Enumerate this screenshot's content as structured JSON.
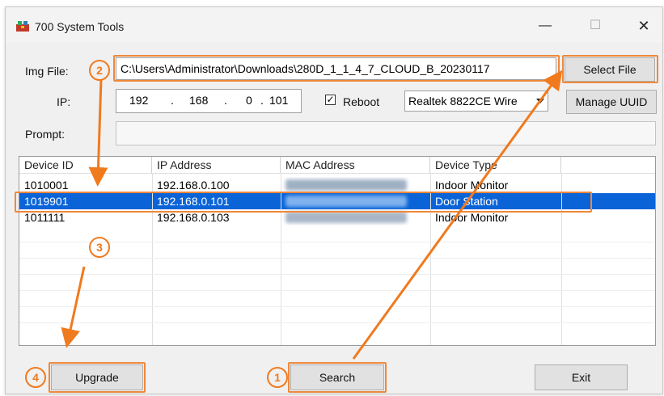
{
  "window": {
    "title": "700 System Tools",
    "controls": {
      "minimize": "—",
      "maximize": "☐",
      "close": "✕"
    }
  },
  "form": {
    "img_file_label": "Img File:",
    "img_file_value": "C:\\Users\\Administrator\\Downloads\\280D_1_1_4_7_CLOUD_B_20230117",
    "select_file_label": "Select File",
    "ip_label": "IP:",
    "ip_octets": [
      "192",
      "168",
      "0",
      "101"
    ],
    "ip_dots": [
      ".",
      ".",
      "."
    ],
    "reboot_label": "Reboot",
    "reboot_checked": "✓",
    "adapter_value": "Realtek 8822CE Wire",
    "manage_uuid_label": "Manage UUID",
    "prompt_label": "Prompt:",
    "prompt_value": ""
  },
  "table": {
    "columns": [
      "Device ID",
      "IP Address",
      "MAC Address",
      "Device Type"
    ],
    "rows": [
      {
        "device_id": "1010001",
        "ip": "192.168.0.100",
        "mac": "",
        "type": "Indoor Monitor"
      },
      {
        "device_id": "1019901",
        "ip": "192.168.0.101",
        "mac": "",
        "type": "Door Station"
      },
      {
        "device_id": "1011111",
        "ip": "192.168.0.103",
        "mac": "",
        "type": "Indoor Monitor"
      }
    ],
    "selected_row": 1
  },
  "buttons": {
    "upgrade": "Upgrade",
    "search": "Search",
    "exit": "Exit"
  },
  "annotations": {
    "step1": "1",
    "step2": "2",
    "step3": "3",
    "step4": "4",
    "accent_color": "#f07a1e"
  }
}
